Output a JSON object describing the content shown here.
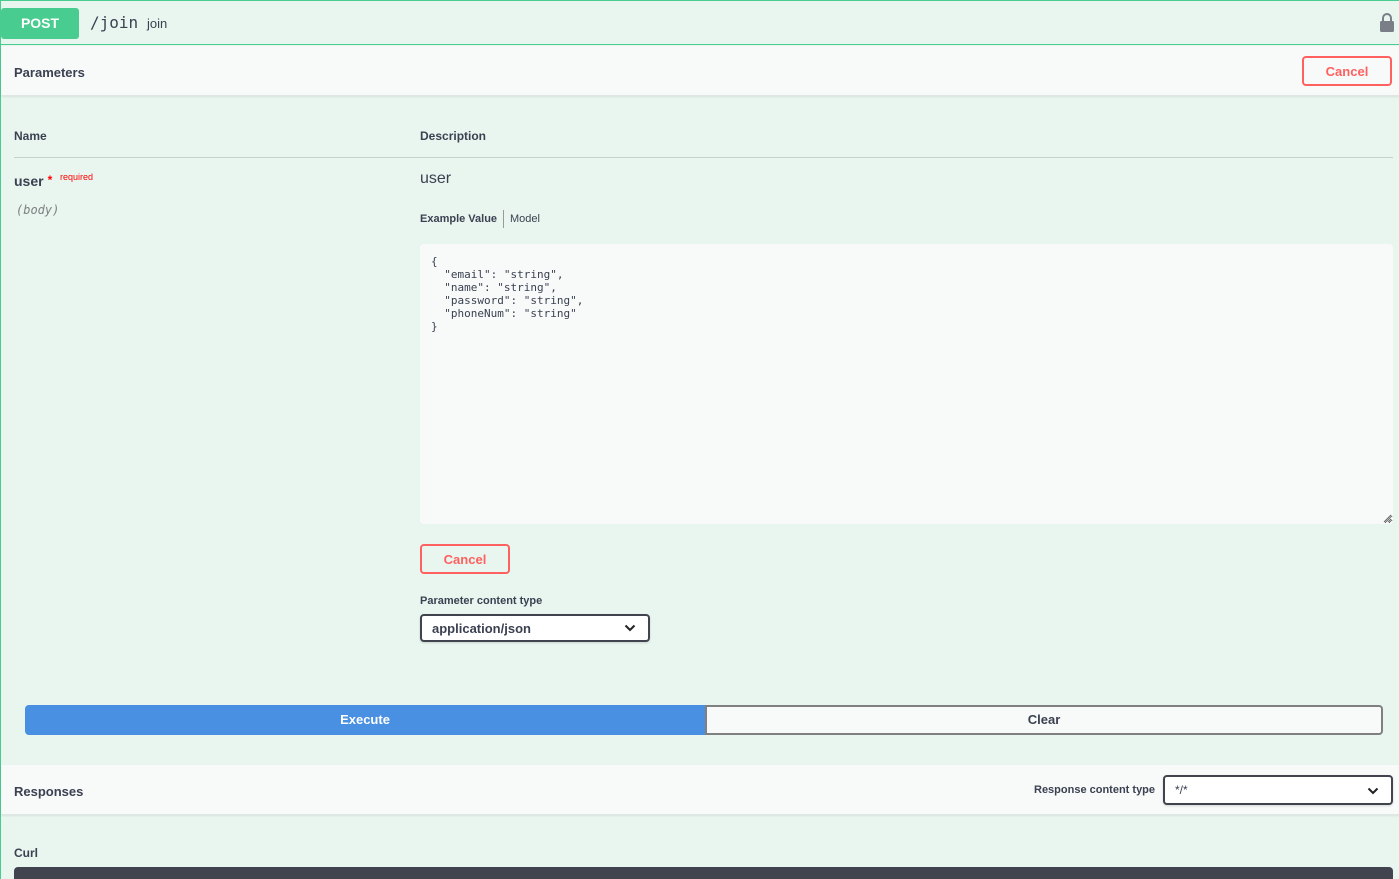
{
  "operation": {
    "method": "POST",
    "path": "/join",
    "summary": "join"
  },
  "parameters_section": {
    "title": "Parameters",
    "cancel_label": "Cancel",
    "col_name": "Name",
    "col_description": "Description"
  },
  "parameter": {
    "name": "user",
    "required_star": "*",
    "required_label": "required",
    "location": "(body)",
    "description": "user",
    "tab_example": "Example Value",
    "tab_model": "Model",
    "body_value": "{\n  \"email\": \"string\",\n  \"name\": \"string\",\n  \"password\": \"string\",\n  \"phoneNum\": \"string\"\n}",
    "cancel_label": "Cancel",
    "content_type_label": "Parameter content type",
    "content_type_value": "application/json"
  },
  "actions": {
    "execute_label": "Execute",
    "clear_label": "Clear"
  },
  "responses_section": {
    "title": "Responses",
    "content_type_label": "Response content type",
    "content_type_value": "*/*"
  },
  "curl": {
    "label": "Curl"
  },
  "colors": {
    "post": "#49cc90",
    "cancel": "#ff6060",
    "execute": "#4990e2",
    "background": "#e8f6ef"
  }
}
